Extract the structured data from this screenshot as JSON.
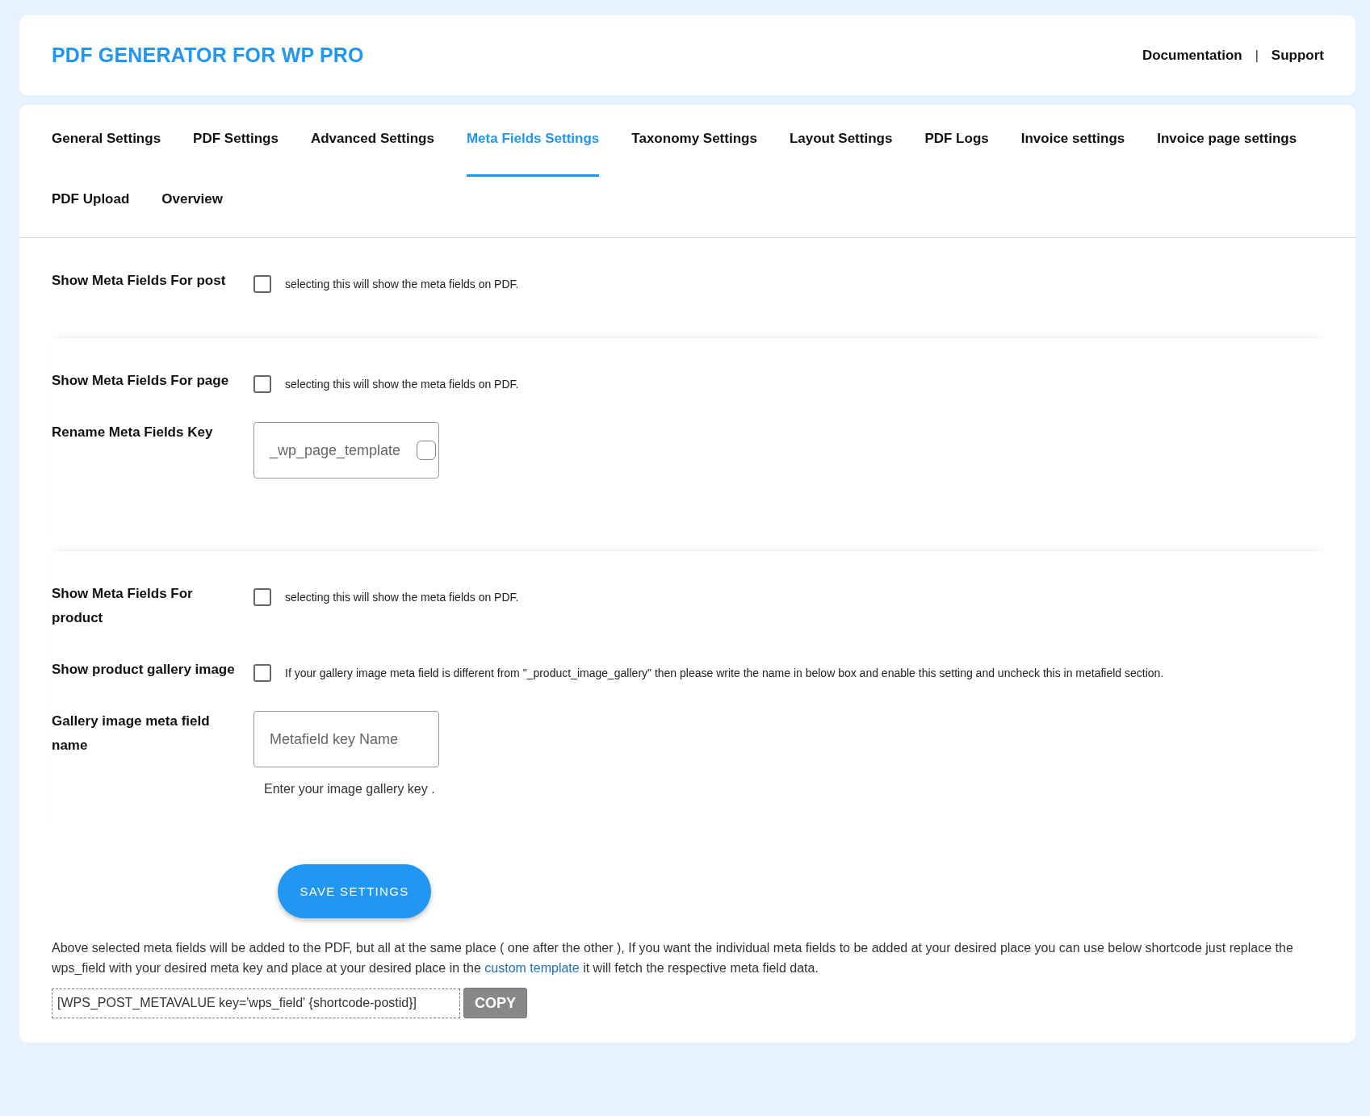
{
  "header": {
    "title": "PDF GENERATOR FOR WP PRO",
    "links": [
      "Documentation",
      "Support"
    ],
    "separator": "|"
  },
  "tabs": [
    {
      "label": "General Settings",
      "selected": false
    },
    {
      "label": "PDF Settings",
      "selected": false
    },
    {
      "label": "Advanced Settings",
      "selected": false
    },
    {
      "label": "Meta Fields Settings",
      "selected": true
    },
    {
      "label": "Taxonomy Settings",
      "selected": false
    },
    {
      "label": "Layout Settings",
      "selected": false
    },
    {
      "label": "PDF Logs",
      "selected": false
    },
    {
      "label": "Invoice settings",
      "selected": false
    },
    {
      "label": "Invoice page settings",
      "selected": false
    },
    {
      "label": "PDF Upload",
      "selected": false
    },
    {
      "label": "Overview",
      "selected": false
    }
  ],
  "sections": [
    {
      "rows": [
        {
          "kind": "checkbox",
          "label": "Show Meta Fields For post",
          "checked": false,
          "description": "selecting this will show the meta fields on PDF."
        }
      ]
    },
    {
      "rows": [
        {
          "kind": "checkbox",
          "label": "Show Meta Fields For page",
          "checked": false,
          "description": "selecting this will show the meta fields on PDF."
        },
        {
          "kind": "key_list",
          "label": "Rename Meta Fields Key",
          "items": [
            {
              "key": "_wp_page_template",
              "checked": false
            }
          ]
        }
      ]
    },
    {
      "rows": [
        {
          "kind": "checkbox",
          "label": "Show Meta Fields For product",
          "checked": false,
          "description": "selecting this will show the meta fields on PDF."
        },
        {
          "kind": "checkbox",
          "label": "Show product gallery image",
          "checked": false,
          "description": "If your gallery image meta field is different from \"_product_image_gallery\" then please write the name in below box and enable this setting and uncheck this in metafield section."
        },
        {
          "kind": "text_input",
          "label": "Gallery image meta field name",
          "placeholder": "Metafield key Name",
          "help": "Enter your image gallery key ."
        }
      ]
    }
  ],
  "save_button": "SAVE SETTINGS",
  "note": {
    "text_before": "Above selected meta fields will be added to the PDF, but all at the same place ( one after the other ), If you want the individual meta fields to be added at your desired place you can use below shortcode just replace the wps_field with your desired meta key and place at your desired place in the",
    "link": "custom template",
    "text_after": "it will fetch the respective meta field data."
  },
  "shortcode": {
    "value": "[WPS_POST_METAVALUE key='wps_field' {shortcode-postid}]",
    "button": "COPY"
  }
}
